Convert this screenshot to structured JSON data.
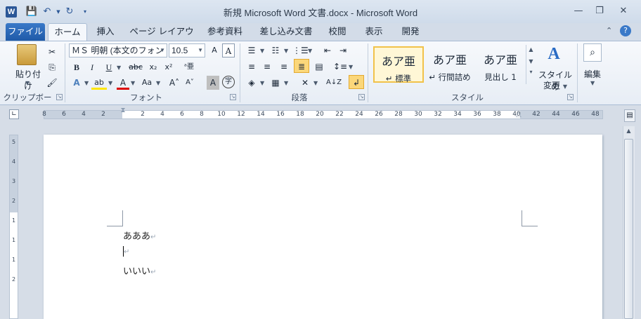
{
  "title_bar": {
    "app_icon_letter": "W",
    "title": "新規 Microsoft Word 文書.docx - Microsoft Word"
  },
  "tabs": [
    {
      "label": "ファイル"
    },
    {
      "label": "ホーム"
    },
    {
      "label": "挿入"
    },
    {
      "label": "ページ レイアウト"
    },
    {
      "label": "参考資料"
    },
    {
      "label": "差し込み文書"
    },
    {
      "label": "校閲"
    },
    {
      "label": "表示"
    },
    {
      "label": "開発"
    }
  ],
  "ribbon": {
    "clipboard": {
      "paste_label": "貼り付け",
      "group_label": "クリップボード"
    },
    "font": {
      "font_name": "ＭＳ 明朝 (本文のフォン",
      "font_size": "10.5",
      "group_label": "フォント"
    },
    "paragraph": {
      "group_label": "段落"
    },
    "styles": {
      "items": [
        {
          "sample": "あア亜",
          "name": "↵ 標準"
        },
        {
          "sample": "あア亜",
          "name": "↵ 行間詰め"
        },
        {
          "sample": "あア亜",
          "name": "見出し 1"
        }
      ],
      "change_label_1": "スタイルの",
      "change_label_2": "変更",
      "group_label": "スタイル"
    },
    "editing": {
      "label": "編集"
    }
  },
  "ruler": {
    "numbers": [
      "8",
      "6",
      "4",
      "2",
      "2",
      "4",
      "6",
      "8",
      "10",
      "12",
      "14",
      "16",
      "18",
      "20",
      "22",
      "24",
      "26",
      "28",
      "30",
      "32",
      "34",
      "36",
      "38",
      "40",
      "42",
      "44",
      "46",
      "48"
    ],
    "vertical_numbers": [
      "5",
      "4",
      "3",
      "2",
      "1",
      "1",
      "1",
      "2"
    ]
  },
  "document": {
    "lines": [
      "あああ",
      "",
      "いいい"
    ],
    "pilcrow": "↵"
  }
}
